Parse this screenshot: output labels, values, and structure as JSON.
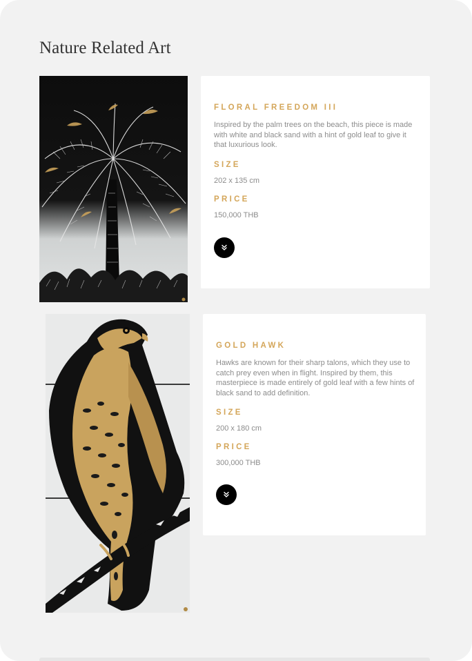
{
  "section": {
    "title": "Nature Related Art"
  },
  "artworks": [
    {
      "title": "FLORAL FREEDOM III",
      "description": "Inspired by the palm trees on the beach, this piece is made with white and black sand with a hint of gold leaf to give it that luxurious look.",
      "size_label": "SIZE",
      "size_value": "202 x 135 cm",
      "price_label": "PRICE",
      "price_value": "150,000 THB",
      "image_icon": "palm-tree-artwork",
      "expand_icon": "chevron-double-down-icon"
    },
    {
      "title": "GOLD HAWK",
      "description": "Hawks are known for their sharp talons, which they use to catch prey even when in flight. Inspired by them, this masterpiece is made entirely of gold leaf with a few hints of black sand to add definition.",
      "size_label": "SIZE",
      "size_value": "200 x 180 cm",
      "price_label": "PRICE",
      "price_value": "300,000 THB",
      "image_icon": "hawk-artwork",
      "expand_icon": "chevron-double-down-icon"
    }
  ],
  "colors": {
    "accent_gold": "#d4a65a",
    "text_gray": "#8c8c8c",
    "background": "#f2f2f2",
    "card": "#ffffff"
  }
}
